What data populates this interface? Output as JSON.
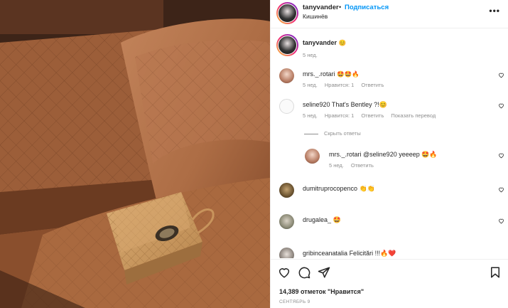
{
  "header": {
    "username": "tanyvander",
    "separator": "•",
    "follow_label": "Подписаться",
    "location": "Кишинёв",
    "more": "•••"
  },
  "caption": {
    "username": "tanyvander",
    "text": "😊",
    "time": "5 нед."
  },
  "comments": [
    {
      "username": "mrs._.rotari",
      "text": "🤩🤩🔥",
      "time": "5 нед.",
      "likes": "Нравится: 1",
      "reply": "Ответить"
    },
    {
      "username": "seline920",
      "text": "That's Bentley ?!😊",
      "time": "5 нед.",
      "likes": "Нравится: 1",
      "reply": "Ответить",
      "translate": "Показать перевод",
      "hide_replies": "Скрыть ответы"
    },
    {
      "username": "mrs._.rotari",
      "text": "@seline920 yeeeep 🤩🔥",
      "time": "5 нед.",
      "reply": "Ответить"
    },
    {
      "username": "dumitruprocopenco",
      "text": "👏👏"
    },
    {
      "username": "drugalea_",
      "text": "🤩"
    },
    {
      "username": "gribinceanatalia",
      "text": "Felicitări !!!🔥❤️"
    }
  ],
  "footer": {
    "likes": "14,389 отметок \"Нравится\"",
    "date": "СЕНТЯБРЬ 9"
  },
  "colors": {
    "link": "#0095f6",
    "muted": "#8e8e8e",
    "text": "#262626",
    "leather": "#a0623d",
    "bag": "#c9975f"
  }
}
